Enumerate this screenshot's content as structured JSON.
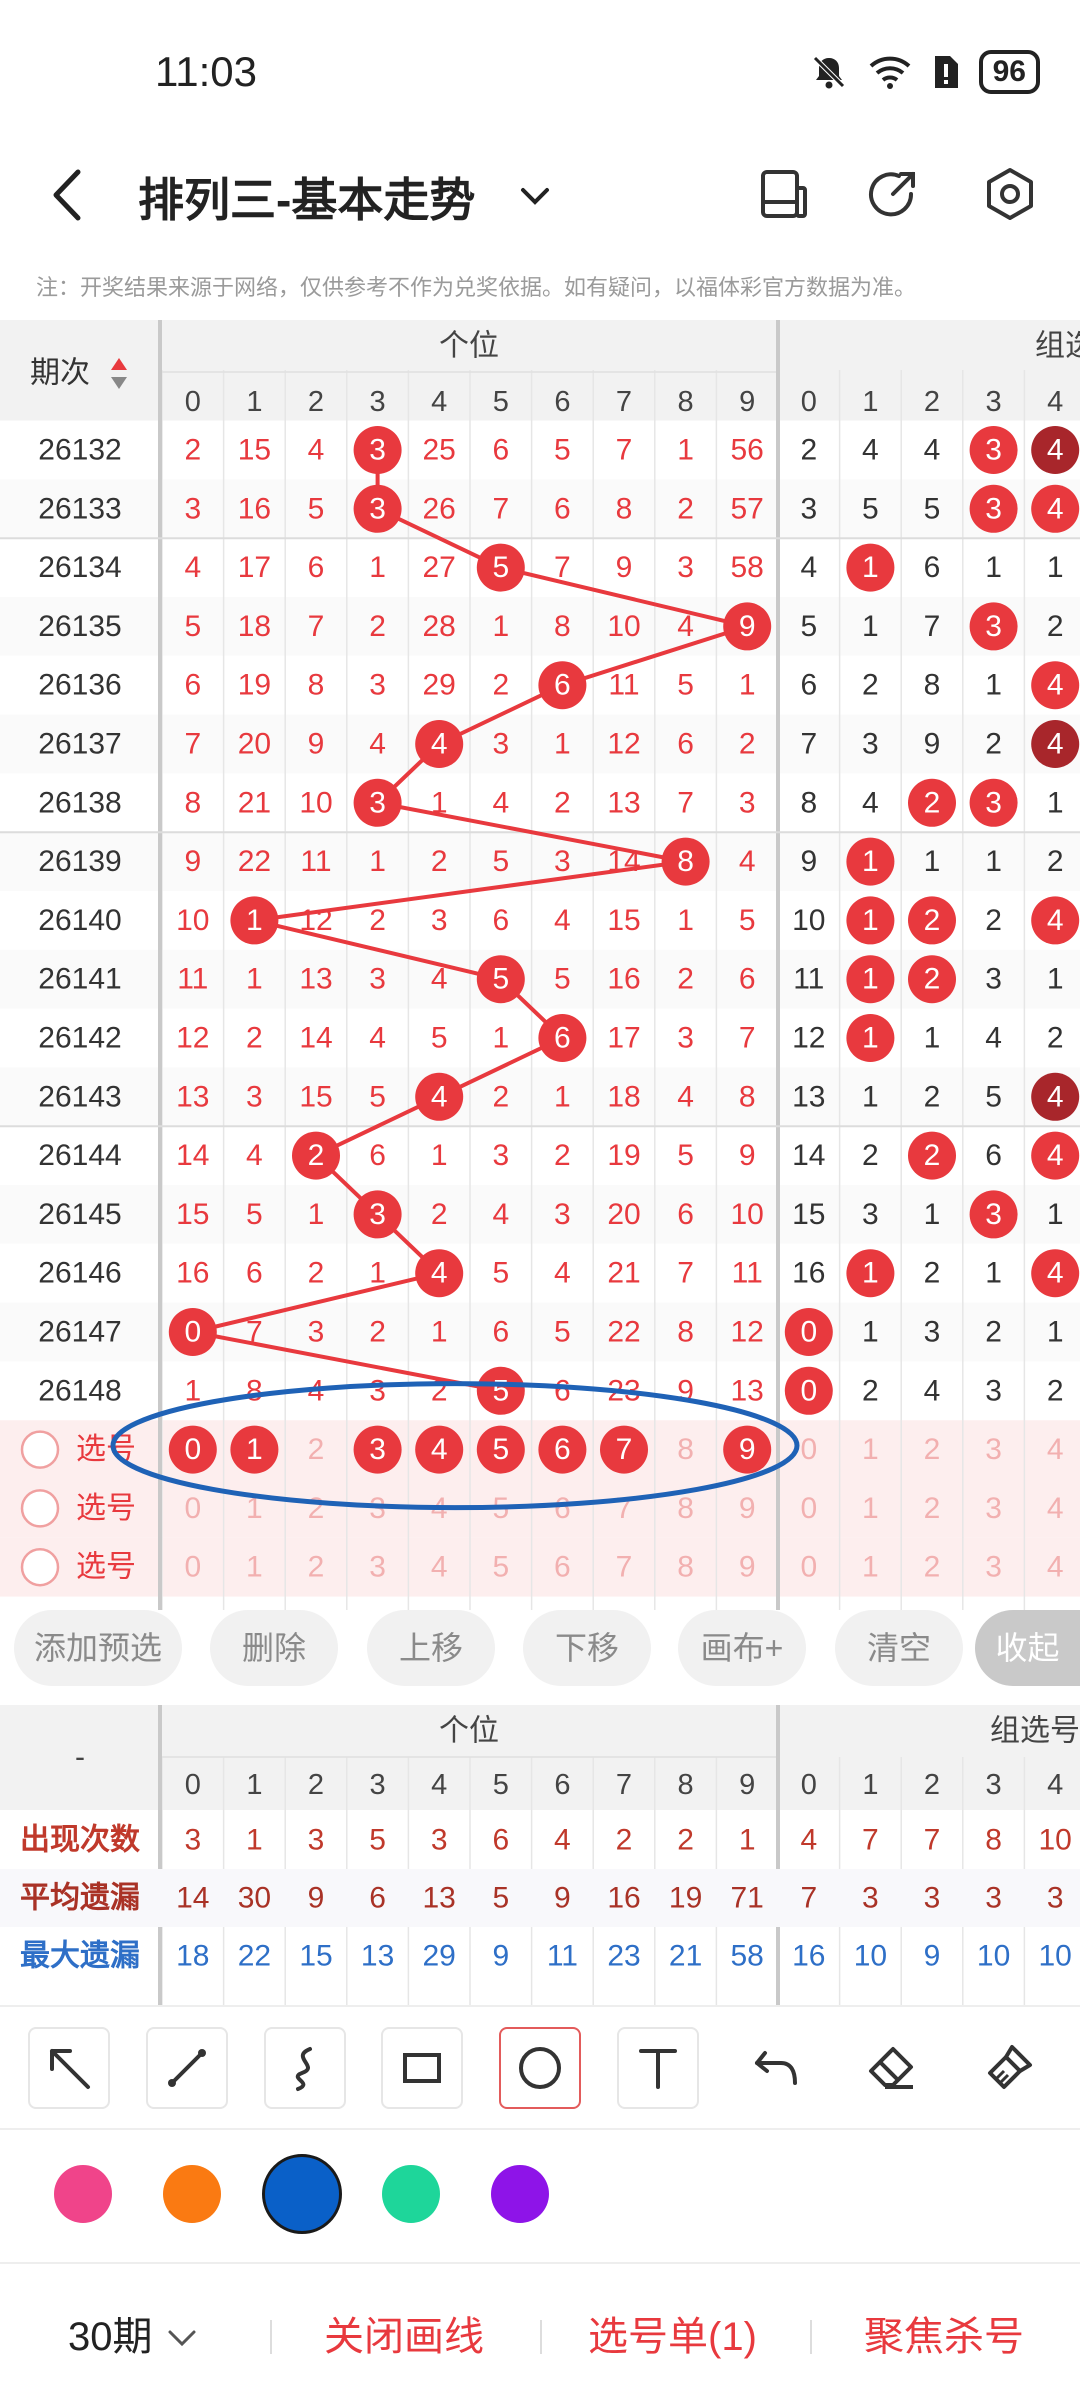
{
  "status": {
    "time": "11:03",
    "battery": "96"
  },
  "header": {
    "title": "排列三-基本走势"
  },
  "notice": "注：开奖结果来源于网络，仅供参考不作为兑奖依据。如有疑问，以福体彩官方数据为准。",
  "table": {
    "period_header": "期次",
    "group_units": "个位",
    "group_pick": "组选号",
    "digits": [
      "0",
      "1",
      "2",
      "3",
      "4",
      "5",
      "6",
      "7",
      "8",
      "9"
    ],
    "pick_digits": [
      "0",
      "1",
      "2",
      "3",
      "4"
    ],
    "rows": [
      {
        "period": "26132",
        "units": [
          "2",
          "15",
          "4",
          "3",
          "25",
          "6",
          "5",
          "7",
          "1",
          "56"
        ],
        "pick": [
          "2",
          "4",
          "4",
          "3",
          "4"
        ],
        "hit": 3,
        "pick_hits": [
          3,
          4
        ],
        "pick_dark": [
          4
        ]
      },
      {
        "period": "26133",
        "units": [
          "3",
          "16",
          "5",
          "3",
          "26",
          "7",
          "6",
          "8",
          "2",
          "57"
        ],
        "pick": [
          "3",
          "5",
          "5",
          "3",
          "4"
        ],
        "hit": 3,
        "pick_hits": [
          3,
          4
        ],
        "pick_dark": []
      },
      {
        "period": "26134",
        "units": [
          "4",
          "17",
          "6",
          "1",
          "27",
          "5",
          "7",
          "9",
          "3",
          "58"
        ],
        "pick": [
          "4",
          "1",
          "6",
          "1",
          "1"
        ],
        "hit": 5,
        "pick_hits": [
          1
        ],
        "pick_dark": []
      },
      {
        "period": "26135",
        "units": [
          "5",
          "18",
          "7",
          "2",
          "28",
          "1",
          "8",
          "10",
          "4",
          "9"
        ],
        "pick": [
          "5",
          "1",
          "7",
          "3",
          "2"
        ],
        "hit": 9,
        "pick_hits": [
          3
        ],
        "pick_dark": []
      },
      {
        "period": "26136",
        "units": [
          "6",
          "19",
          "8",
          "3",
          "29",
          "2",
          "6",
          "11",
          "5",
          "1"
        ],
        "pick": [
          "6",
          "2",
          "8",
          "1",
          "4"
        ],
        "hit": 6,
        "pick_hits": [
          4
        ],
        "pick_dark": []
      },
      {
        "period": "26137",
        "units": [
          "7",
          "20",
          "9",
          "4",
          "4",
          "3",
          "1",
          "12",
          "6",
          "2"
        ],
        "pick": [
          "7",
          "3",
          "9",
          "2",
          "4"
        ],
        "hit": 4,
        "pick_hits": [
          4
        ],
        "pick_dark": [
          4
        ]
      },
      {
        "period": "26138",
        "units": [
          "8",
          "21",
          "10",
          "3",
          "1",
          "4",
          "2",
          "13",
          "7",
          "3"
        ],
        "pick": [
          "8",
          "4",
          "2",
          "3",
          "1"
        ],
        "hit": 3,
        "pick_hits": [
          2,
          3
        ],
        "pick_dark": []
      },
      {
        "period": "26139",
        "units": [
          "9",
          "22",
          "11",
          "1",
          "2",
          "5",
          "3",
          "14",
          "8",
          "4"
        ],
        "pick": [
          "9",
          "1",
          "1",
          "1",
          "2"
        ],
        "hit": 8,
        "pick_hits": [
          1
        ],
        "pick_dark": []
      },
      {
        "period": "26140",
        "units": [
          "10",
          "1",
          "12",
          "2",
          "3",
          "6",
          "4",
          "15",
          "1",
          "5"
        ],
        "pick": [
          "10",
          "1",
          "2",
          "2",
          "4"
        ],
        "hit": 1,
        "pick_hits": [
          1,
          2,
          4
        ],
        "pick_dark": []
      },
      {
        "period": "26141",
        "units": [
          "11",
          "1",
          "13",
          "3",
          "4",
          "5",
          "5",
          "16",
          "2",
          "6"
        ],
        "pick": [
          "11",
          "1",
          "2",
          "3",
          "1"
        ],
        "hit": 5,
        "pick_hits": [
          1,
          2
        ],
        "pick_dark": []
      },
      {
        "period": "26142",
        "units": [
          "12",
          "2",
          "14",
          "4",
          "5",
          "1",
          "6",
          "17",
          "3",
          "7"
        ],
        "pick": [
          "12",
          "1",
          "1",
          "4",
          "2"
        ],
        "hit": 6,
        "pick_hits": [
          1
        ],
        "pick_dark": []
      },
      {
        "period": "26143",
        "units": [
          "13",
          "3",
          "15",
          "5",
          "4",
          "2",
          "1",
          "18",
          "4",
          "8"
        ],
        "pick": [
          "13",
          "1",
          "2",
          "5",
          "4"
        ],
        "hit": 4,
        "pick_hits": [
          4
        ],
        "pick_dark": [
          4
        ]
      },
      {
        "period": "26144",
        "units": [
          "14",
          "4",
          "2",
          "6",
          "1",
          "3",
          "2",
          "19",
          "5",
          "9"
        ],
        "pick": [
          "14",
          "2",
          "2",
          "6",
          "4"
        ],
        "hit": 2,
        "pick_hits": [
          2,
          4
        ],
        "pick_dark": []
      },
      {
        "period": "26145",
        "units": [
          "15",
          "5",
          "1",
          "3",
          "2",
          "4",
          "3",
          "20",
          "6",
          "10"
        ],
        "pick": [
          "15",
          "3",
          "1",
          "3",
          "1"
        ],
        "hit": 3,
        "pick_hits": [
          3
        ],
        "pick_dark": []
      },
      {
        "period": "26146",
        "units": [
          "16",
          "6",
          "2",
          "1",
          "4",
          "5",
          "4",
          "21",
          "7",
          "11"
        ],
        "pick": [
          "16",
          "1",
          "2",
          "1",
          "4"
        ],
        "hit": 4,
        "pick_hits": [
          1,
          4
        ],
        "pick_dark": []
      },
      {
        "period": "26147",
        "units": [
          "0",
          "7",
          "3",
          "2",
          "1",
          "6",
          "5",
          "22",
          "8",
          "12"
        ],
        "pick": [
          "0",
          "1",
          "3",
          "2",
          "1"
        ],
        "hit": 0,
        "pick_hits": [
          0
        ],
        "pick_dark": []
      },
      {
        "period": "26148",
        "units": [
          "1",
          "8",
          "4",
          "3",
          "2",
          "5",
          "6",
          "23",
          "9",
          "13"
        ],
        "pick": [
          "0",
          "2",
          "4",
          "3",
          "2"
        ],
        "hit": 5,
        "pick_hits": [
          0
        ],
        "pick_dark": []
      }
    ],
    "select_label": "选号",
    "select_rows": [
      {
        "units_selected": [
          0,
          1,
          3,
          4,
          5,
          6,
          7,
          9
        ]
      },
      {
        "units_selected": []
      },
      {
        "units_selected": []
      }
    ]
  },
  "actions": [
    "添加预选",
    "删除",
    "上移",
    "下移",
    "画布+",
    "清空",
    "收起"
  ],
  "stats": {
    "corner": "-",
    "rows": [
      {
        "label": "出现次数",
        "units": [
          "3",
          "1",
          "3",
          "5",
          "3",
          "6",
          "4",
          "2",
          "2",
          "1"
        ],
        "pick": [
          "4",
          "7",
          "7",
          "8",
          "10"
        ],
        "color": "#c0392b"
      },
      {
        "label": "平均遗漏",
        "units": [
          "14",
          "30",
          "9",
          "6",
          "13",
          "5",
          "9",
          "16",
          "19",
          "71"
        ],
        "pick": [
          "7",
          "3",
          "3",
          "3",
          "3"
        ],
        "color": "#a93226"
      },
      {
        "label": "最大遗漏",
        "units": [
          "18",
          "22",
          "15",
          "13",
          "29",
          "9",
          "11",
          "23",
          "21",
          "58"
        ],
        "pick": [
          "16",
          "10",
          "9",
          "10",
          "10"
        ],
        "color": "#2e6fc7"
      }
    ]
  },
  "draw_tools": [
    "arrow-icon",
    "line-icon",
    "curve-icon",
    "rect-icon",
    "circle-icon",
    "text-icon",
    "undo-icon",
    "eraser-icon",
    "clear-brush-icon"
  ],
  "colors": [
    "#f0448a",
    "#fa7a12",
    "#0a60c8",
    "#1ed69a",
    "#8e14e8"
  ],
  "bottom": {
    "periods": "30期",
    "close_draw": "关闭画线",
    "pick_list": "选号单(1)",
    "focus": "聚焦杀号"
  },
  "theme": {
    "red": "#e8393e",
    "dark_red": "#a8262b",
    "annotation_blue": "#1f62b6"
  }
}
